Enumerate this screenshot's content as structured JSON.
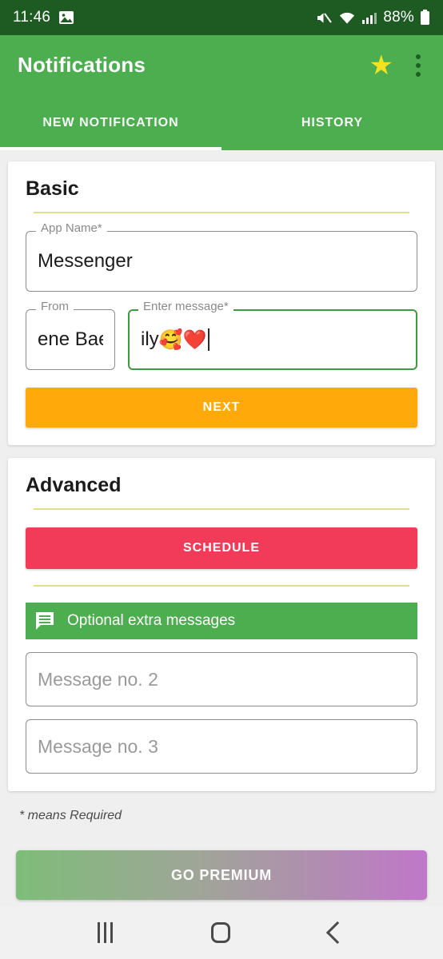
{
  "statusbar": {
    "time": "11:46",
    "photo_icon": "image-notification-icon",
    "mute_icon": "volume-mute-icon",
    "wifi_icon": "wifi-icon",
    "signal_icon": "cellular-signal-icon",
    "battery_percent": "88%",
    "battery_icon": "battery-icon",
    "bg_color": "#1e5b22"
  },
  "appbar": {
    "title": "Notifications",
    "star_icon": "star-icon",
    "overflow_icon": "more-vertical-icon",
    "bg_color": "#4cae4f",
    "star_color": "#f2e220"
  },
  "tabs": [
    {
      "label": "NEW NOTIFICATION",
      "active": true
    },
    {
      "label": "HISTORY",
      "active": false
    }
  ],
  "basic_card": {
    "title": "Basic",
    "app_name": {
      "label": "App Name*",
      "value": "Messenger"
    },
    "from": {
      "label": "From",
      "value": "ene Bae"
    },
    "message": {
      "label": "Enter message*",
      "value": "ily ",
      "emoji": "🥰❤️",
      "focused": true
    },
    "next_button": {
      "label": "NEXT",
      "color": "#ffa90b"
    }
  },
  "advanced_card": {
    "title": "Advanced",
    "schedule_button": {
      "label": "SCHEDULE",
      "color": "#f23b58"
    },
    "extra_messages_bar": {
      "label": "Optional extra messages",
      "icon": "message-bubble-icon",
      "color": "#4cae4f"
    },
    "message2_placeholder": "Message no. 2",
    "message2_value": "",
    "message3_placeholder": "Message no. 3",
    "message3_value": ""
  },
  "footer": {
    "required_note": "* means Required",
    "premium_button": {
      "label": "GO PREMIUM",
      "gradient_from": "#7ebd79",
      "gradient_to": "#c077c8"
    }
  },
  "navbar": {
    "recents": "recents-icon",
    "home": "home-icon",
    "back": "back-icon"
  },
  "theme": {
    "divider_color": "#dfe08a",
    "page_bg": "#efefef"
  }
}
